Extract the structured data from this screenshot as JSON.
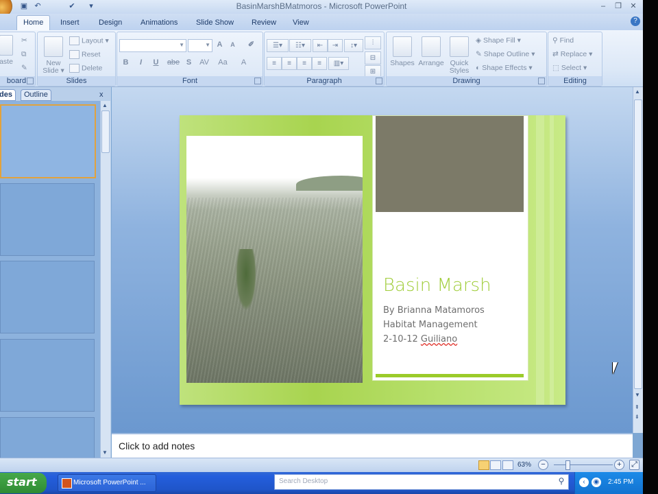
{
  "window": {
    "title": "BasinMarshBMatmoros - Microsoft PowerPoint"
  },
  "tabs": [
    "Home",
    "Insert",
    "Design",
    "Animations",
    "Slide Show",
    "Review",
    "View"
  ],
  "ribbon": {
    "clipboard": {
      "paste": "aste",
      "label": "board"
    },
    "slides": {
      "new_slide_line1": "New",
      "new_slide_line2": "Slide",
      "layout": "Layout",
      "reset": "Reset",
      "delete": "Delete",
      "label": "Slides"
    },
    "font": {
      "label": "Font",
      "bold": "B",
      "italic": "I",
      "underline": "U",
      "strike": "abe",
      "shadow": "S",
      "spacing": "AV",
      "case": "Aa",
      "color": "A",
      "grow": "A",
      "shrink": "A"
    },
    "paragraph": {
      "label": "Paragraph"
    },
    "drawing": {
      "shapes": "Shapes",
      "arrange": "Arrange",
      "quick_styles_line1": "Quick",
      "quick_styles_line2": "Styles",
      "shape_fill": "Shape Fill",
      "shape_outline": "Shape Outline",
      "shape_effects": "Shape Effects",
      "label": "Drawing"
    },
    "editing": {
      "find": "Find",
      "replace": "Replace",
      "select": "Select",
      "label": "Editing"
    }
  },
  "pane": {
    "tab_slides": "des",
    "tab_outline": "Outline",
    "close": "x"
  },
  "slide": {
    "title": "Basin Marsh",
    "line1": "By Brianna Matamoros",
    "line2": "Habitat Management",
    "line3_date": "2-10-12",
    "line3_name": "Guiliano"
  },
  "notes": {
    "placeholder": "Click to add notes"
  },
  "status": {
    "zoom": "63%",
    "minus": "−",
    "plus": "+"
  },
  "taskbar": {
    "start": "start",
    "task_item": "Microsoft PowerPoint ...",
    "search_placeholder": "Search Desktop",
    "clock": "2:45 PM"
  },
  "colors": {
    "slide_title": "#a0cd3a",
    "slide_text": "#6e6e6e",
    "slide_bg": "#a8d44f",
    "taskbar": "#245edc",
    "start": "#3a9b3e"
  }
}
